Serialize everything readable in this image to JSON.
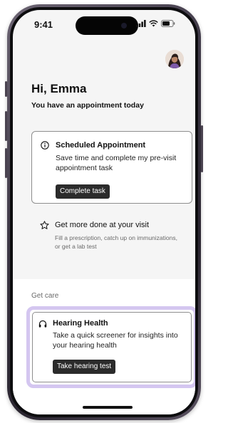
{
  "status_bar": {
    "time": "9:41"
  },
  "home": {
    "greeting": "Hi, Emma",
    "subgreeting": "You have an appointment today"
  },
  "appointment_card": {
    "title": "Scheduled Appointment",
    "description": "Save time and complete my pre-visit appointment task",
    "button_label": "Complete task",
    "icon": "info-icon"
  },
  "visit_prompt": {
    "title": "Get more done at your visit",
    "description": "Fill a prescription, catch up on immunizations, or get a lab test",
    "icon": "star-icon"
  },
  "care": {
    "section_label": "Get care",
    "hearing_card": {
      "title": "Hearing Health",
      "description": "Take a quick screener for insights into your hearing health",
      "button_label": "Take hearing test",
      "icon": "headphones-icon",
      "highlight_color": "#d4c6f0"
    }
  },
  "colors": {
    "button_bg": "#2b2b2b",
    "screen_bg": "#f5f5f5",
    "highlight": "#d4c6f0"
  }
}
